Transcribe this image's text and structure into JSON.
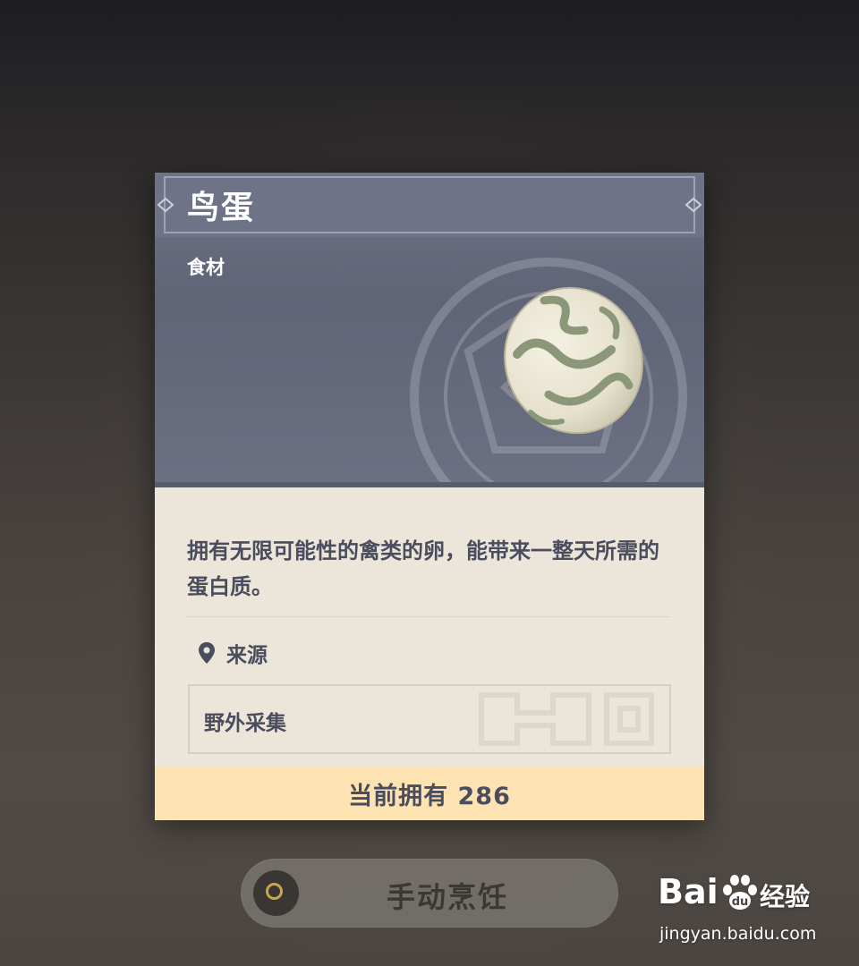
{
  "item": {
    "title": "鸟蛋",
    "category": "食材",
    "description": "拥有无限可能性的禽类的卵，能带来一整天所需的蛋白质。",
    "source_heading": "来源",
    "source_value": "野外采集",
    "owned_label": "当前拥有 286"
  },
  "actions": {
    "cook_label": "手动烹饪"
  },
  "watermark": {
    "logo_text_left": "Bai",
    "logo_text_right": "经验",
    "url": "jingyan.baidu.com"
  },
  "icons": {
    "source": "location-pin-icon",
    "cook": "ring-icon",
    "item_image": "egg-icon"
  },
  "colors": {
    "card_body": "#ece5da",
    "header": "#6f7388",
    "owned_bar": "#fde3b2",
    "text": "#4a4d5d",
    "accent_ring": "#c9a74a"
  }
}
